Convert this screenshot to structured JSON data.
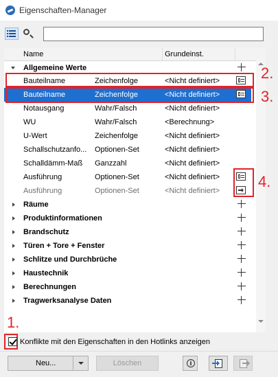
{
  "window": {
    "title": "Eigenschaften-Manager"
  },
  "search": {
    "value": "",
    "placeholder": ""
  },
  "table": {
    "headers": {
      "name": "Name",
      "default": "Grundeinst."
    },
    "group_open": {
      "label": "Allgemeine Werte"
    },
    "rows": [
      {
        "name": "Bauteilname",
        "type": "Zeichenfolge",
        "default": "<Nicht definiert>"
      },
      {
        "name": "Bauteilname",
        "type": "Zeichenfolge",
        "default": "<Nicht definiert>"
      },
      {
        "name": "Notausgang",
        "type": "Wahr/Falsch",
        "default": "<Nicht definiert>"
      },
      {
        "name": "WU",
        "type": "Wahr/Falsch",
        "default": "<Berechnung>"
      },
      {
        "name": "U-Wert",
        "type": "Zeichenfolge",
        "default": "<Nicht definiert>"
      },
      {
        "name": "Schallschutzanfo...",
        "type": "Optionen-Set",
        "default": "<Nicht definiert>"
      },
      {
        "name": "Schalldämm-Maß",
        "type": "Ganzzahl",
        "default": "<Nicht definiert>"
      },
      {
        "name": "Ausführung",
        "type": "Optionen-Set",
        "default": "<Nicht definiert>"
      },
      {
        "name": "Ausführung",
        "type": "Optionen-Set",
        "default": "<Nicht definiert>"
      }
    ],
    "groups": [
      "Räume",
      "Produktinformationen",
      "Brandschutz",
      "Türen + Tore + Fenster",
      "Schlitze und Durchbrüche",
      "Haustechnik",
      "Berechnungen",
      "Tragwerksanalyse Daten"
    ]
  },
  "option": {
    "label": "Konflikte mit den Eigenschaften in den Hotlinks anzeigen",
    "checked": true
  },
  "buttons": {
    "new": "Neu...",
    "delete": "Löschen",
    "info": "i"
  },
  "annotations": {
    "n1": "1.",
    "n2": "2.",
    "n3": "3.",
    "n4": "4."
  },
  "colors": {
    "selection": "#1e6fcf",
    "annotation": "#e0242b"
  }
}
